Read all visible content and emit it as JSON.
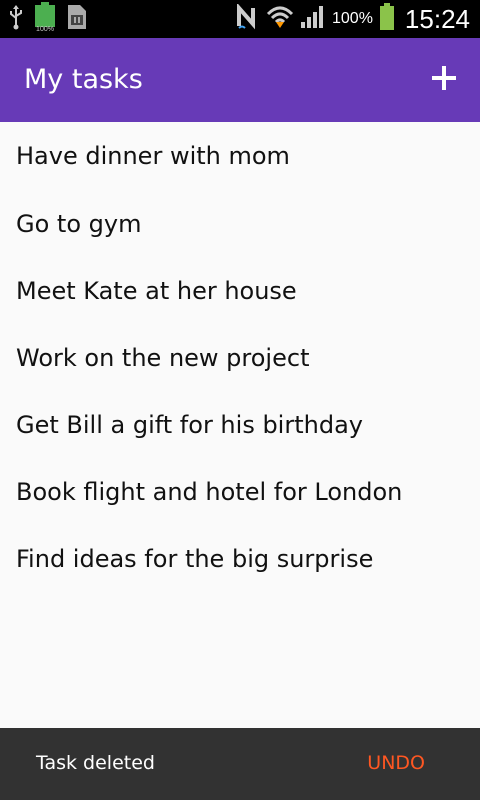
{
  "status_bar": {
    "battery_percent": "100%",
    "time": "15:24",
    "icons": [
      "usb-icon",
      "battery-full-icon",
      "sim-card-icon",
      "nfc-icon",
      "wifi-icon",
      "signal-icon",
      "battery-charging-icon"
    ]
  },
  "app_bar": {
    "title": "My tasks",
    "add_icon": "plus-icon"
  },
  "tasks": [
    "Have dinner with mom",
    "Go to gym",
    "Meet Kate at her house",
    "Work on the new project",
    "Get Bill a gift for his birthday",
    "Book flight and hotel for London",
    "Find ideas for the big surprise"
  ],
  "snackbar": {
    "message": "Task deleted",
    "action": "UNDO"
  },
  "colors": {
    "app_bar": "#673ab7",
    "undo": "#ff5722",
    "snackbar_bg": "#323232",
    "list_bg": "#fafafa"
  }
}
